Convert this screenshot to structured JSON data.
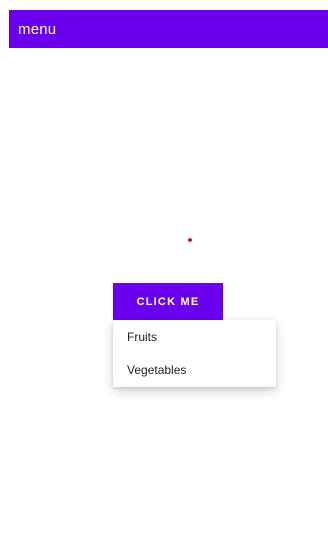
{
  "app_bar": {
    "title": "menu",
    "color": "#6a00ee"
  },
  "indicator": {
    "color": "#e3161b"
  },
  "button": {
    "label": "CLICK ME",
    "color": "#6a00ee"
  },
  "popup_menu": {
    "items": [
      {
        "label": "Fruits"
      },
      {
        "label": "Vegetables"
      }
    ]
  }
}
